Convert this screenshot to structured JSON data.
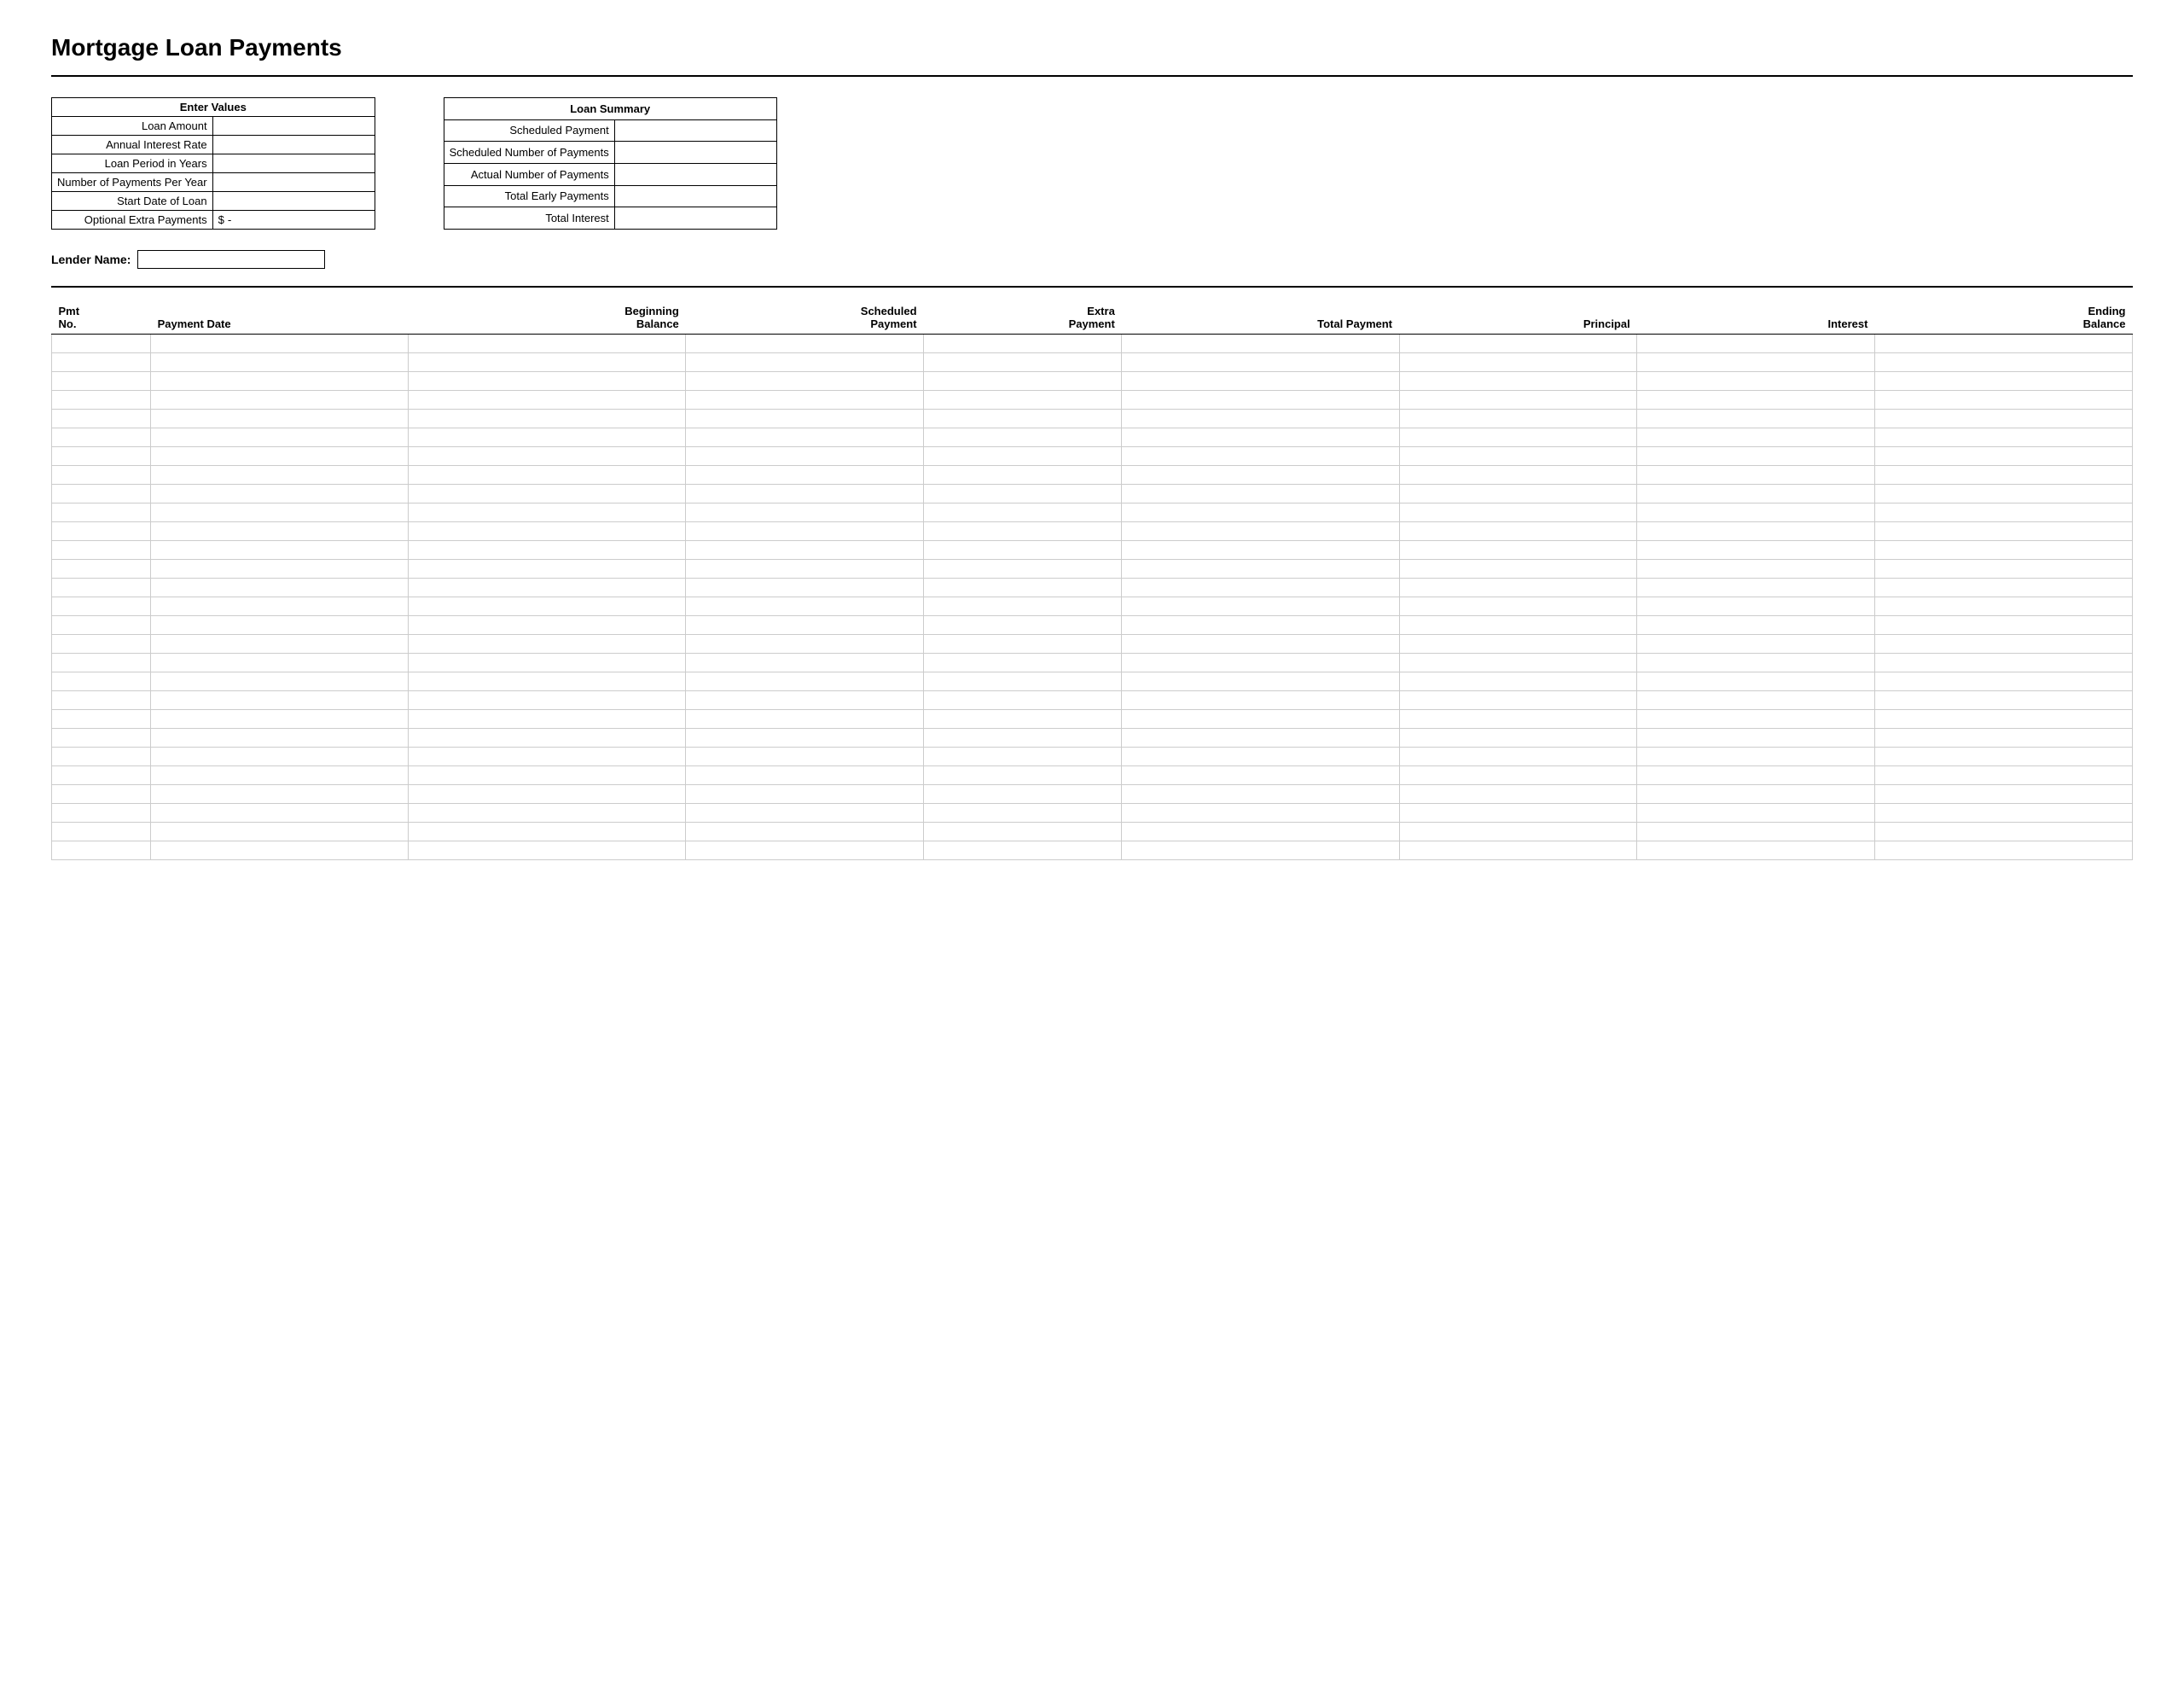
{
  "title": "Mortgage Loan Payments",
  "enter_values": {
    "header": "Enter Values",
    "fields": [
      {
        "label": "Loan Amount",
        "value": ""
      },
      {
        "label": "Annual Interest Rate",
        "value": ""
      },
      {
        "label": "Loan Period in Years",
        "value": ""
      },
      {
        "label": "Number of Payments Per Year",
        "value": ""
      },
      {
        "label": "Start Date of Loan",
        "value": ""
      },
      {
        "label": "Optional Extra Payments",
        "prefix": "$",
        "value": "-"
      }
    ]
  },
  "loan_summary": {
    "header": "Loan Summary",
    "fields": [
      {
        "label": "Scheduled Payment",
        "value": ""
      },
      {
        "label": "Scheduled Number of Payments",
        "value": ""
      },
      {
        "label": "Actual Number of Payments",
        "value": ""
      },
      {
        "label": "Total Early Payments",
        "value": ""
      },
      {
        "label": "Total Interest",
        "value": ""
      }
    ]
  },
  "lender": {
    "label": "Lender Name:",
    "value": ""
  },
  "table": {
    "columns": [
      {
        "line1": "Pmt",
        "line2": "No."
      },
      {
        "line1": "",
        "line2": "Payment Date"
      },
      {
        "line1": "Beginning",
        "line2": "Balance"
      },
      {
        "line1": "Scheduled",
        "line2": "Payment"
      },
      {
        "line1": "Extra",
        "line2": "Payment"
      },
      {
        "line1": "",
        "line2": "Total Payment"
      },
      {
        "line1": "",
        "line2": "Principal"
      },
      {
        "line1": "",
        "line2": "Interest"
      },
      {
        "line1": "Ending",
        "line2": "Balance"
      }
    ],
    "row_count": 28
  }
}
